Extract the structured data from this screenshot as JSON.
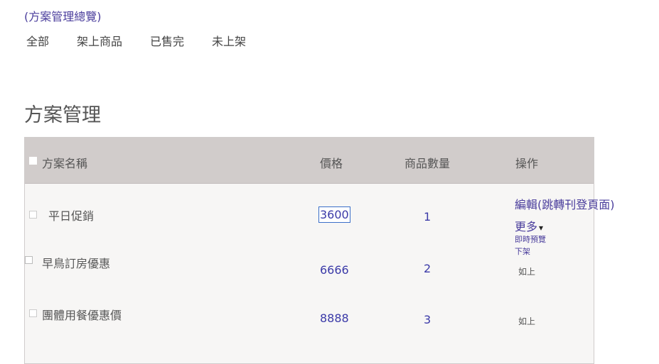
{
  "breadcrumb": "(方案管理總覽)",
  "filters": [
    "全部",
    "架上商品",
    "已售完",
    "未上架"
  ],
  "page_title": "方案管理",
  "table": {
    "headers": {
      "name": "方案名稱",
      "price": "價格",
      "qty": "商品數量",
      "ops": "操作"
    },
    "rows": [
      {
        "name": "平日促銷",
        "price": "3600",
        "qty": "1"
      },
      {
        "name": "早鳥訂房優惠",
        "price": "6666",
        "qty": "2"
      },
      {
        "name": "團體用餐優惠價",
        "price": "8888",
        "qty": "3"
      }
    ],
    "ops": {
      "edit": "編輯(跳轉刊登頁面)",
      "more": "更多",
      "more_arrow": "▾",
      "preview": "即時預覽",
      "unlist": "下架",
      "same": "如上"
    }
  }
}
